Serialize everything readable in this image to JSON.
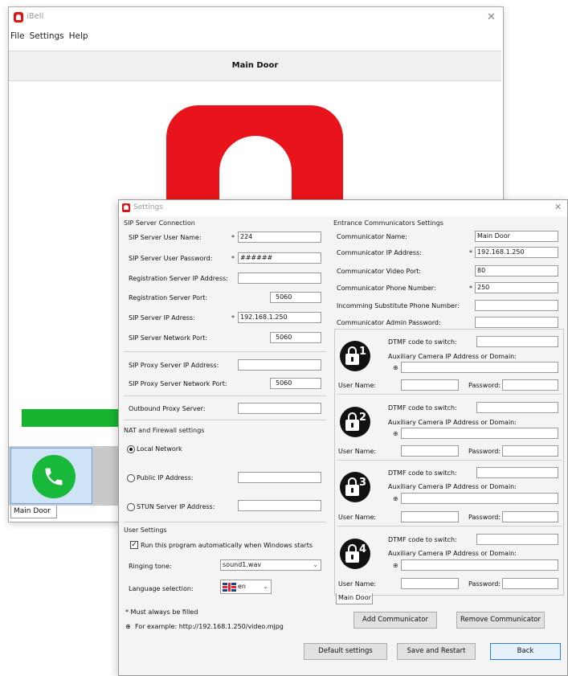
{
  "main_window": {
    "title": "iBell",
    "menu": [
      "File",
      "Settings",
      "Help"
    ],
    "door_title": "Main Door",
    "progress_fraction": 1.0,
    "tab_label": "Main Door",
    "colors": {
      "bell_red": "#e8131b",
      "call_green": "#18b83a",
      "progress_green": "#16b42f"
    },
    "icons": [
      "bell-logo-icon",
      "phone-icon",
      "close-icon"
    ]
  },
  "settings": {
    "title": "Settings",
    "sip": {
      "header": "SIP Server Connection",
      "user_name_label": "SIP Server User Name:",
      "user_name_value": "224",
      "password_label": "SIP Server User Password:",
      "password_value": "######",
      "reg_ip_label": "Registration Server IP Address:",
      "reg_ip_value": "",
      "reg_port_label": "Registration Server Port:",
      "reg_port_value": "5060",
      "ip_label": "SIP Server IP Adress:",
      "ip_value": "192.168.1.250",
      "net_port_label": "SIP Server Network Port:",
      "net_port_value": "5060",
      "proxy_ip_label": "SIP Proxy Server IP Address:",
      "proxy_ip_value": "",
      "proxy_port_label": "SIP Proxy Server Network Port:",
      "proxy_port_value": "5060",
      "outbound_label": "Outbound Proxy Server:",
      "outbound_value": ""
    },
    "nat": {
      "header": "NAT and Firewall settings",
      "local_label": "Local Network",
      "public_label": "Public IP Address:",
      "public_value": "",
      "stun_label": "STUN Server IP Address:",
      "stun_value": "",
      "selected": "local"
    },
    "user": {
      "header": "User Settings",
      "autorun_label": "Run this program automatically when Windows starts",
      "autorun_checked": true,
      "ringing_label": "Ringing tone:",
      "ringing_value": "sound1.wav",
      "language_label": "Language selection:",
      "language_value": "en"
    },
    "notes": {
      "required": "* Must always be filled",
      "example": "For example:  http://192.168.1.250/video.mjpg"
    },
    "required_mark": "*",
    "entrance": {
      "header": "Entrance Communicators Settings",
      "name_label": "Communicator Name:",
      "name_value": "Main Door",
      "ip_label": "Communicator IP Address:",
      "ip_value": "192.168.1.250",
      "video_port_label": "Communicator Video Port:",
      "video_port_value": "80",
      "phone_label": "Communicator Phone Number:",
      "phone_value": "250",
      "substitute_label": "Incomming Substitute Phone Number:",
      "substitute_value": "",
      "admin_pw_label": "Communicator Admin Password:",
      "admin_pw_value": "",
      "switches": [
        {
          "num": "1",
          "dtmf_label": "DTMF code to switch:",
          "aux_label": "Auxiliary Camera IP Address or Domain:",
          "user_label": "User Name:",
          "password_label": "Password:"
        },
        {
          "num": "2",
          "dtmf_label": "DTMF code to switch:",
          "aux_label": "Auxiliary Camera IP Address or Domain:",
          "user_label": "User Name:",
          "password_label": "Password:"
        },
        {
          "num": "3",
          "dtmf_label": "DTMF code to switch:",
          "aux_label": "Auxiliary Camera IP Address or Domain:",
          "user_label": "User Name:",
          "password_label": "Password:"
        },
        {
          "num": "4",
          "dtmf_label": "DTMF code to switch:",
          "aux_label": "Auxiliary Camera IP Address or Domain:",
          "user_label": "User Name:",
          "password_label": "Password:"
        }
      ],
      "tab_label": "Main Door",
      "add_button": "Add Communicator",
      "remove_button": "Remove Communicator"
    },
    "buttons": {
      "default": "Default settings",
      "save": "Save and Restart",
      "back": "Back"
    }
  }
}
